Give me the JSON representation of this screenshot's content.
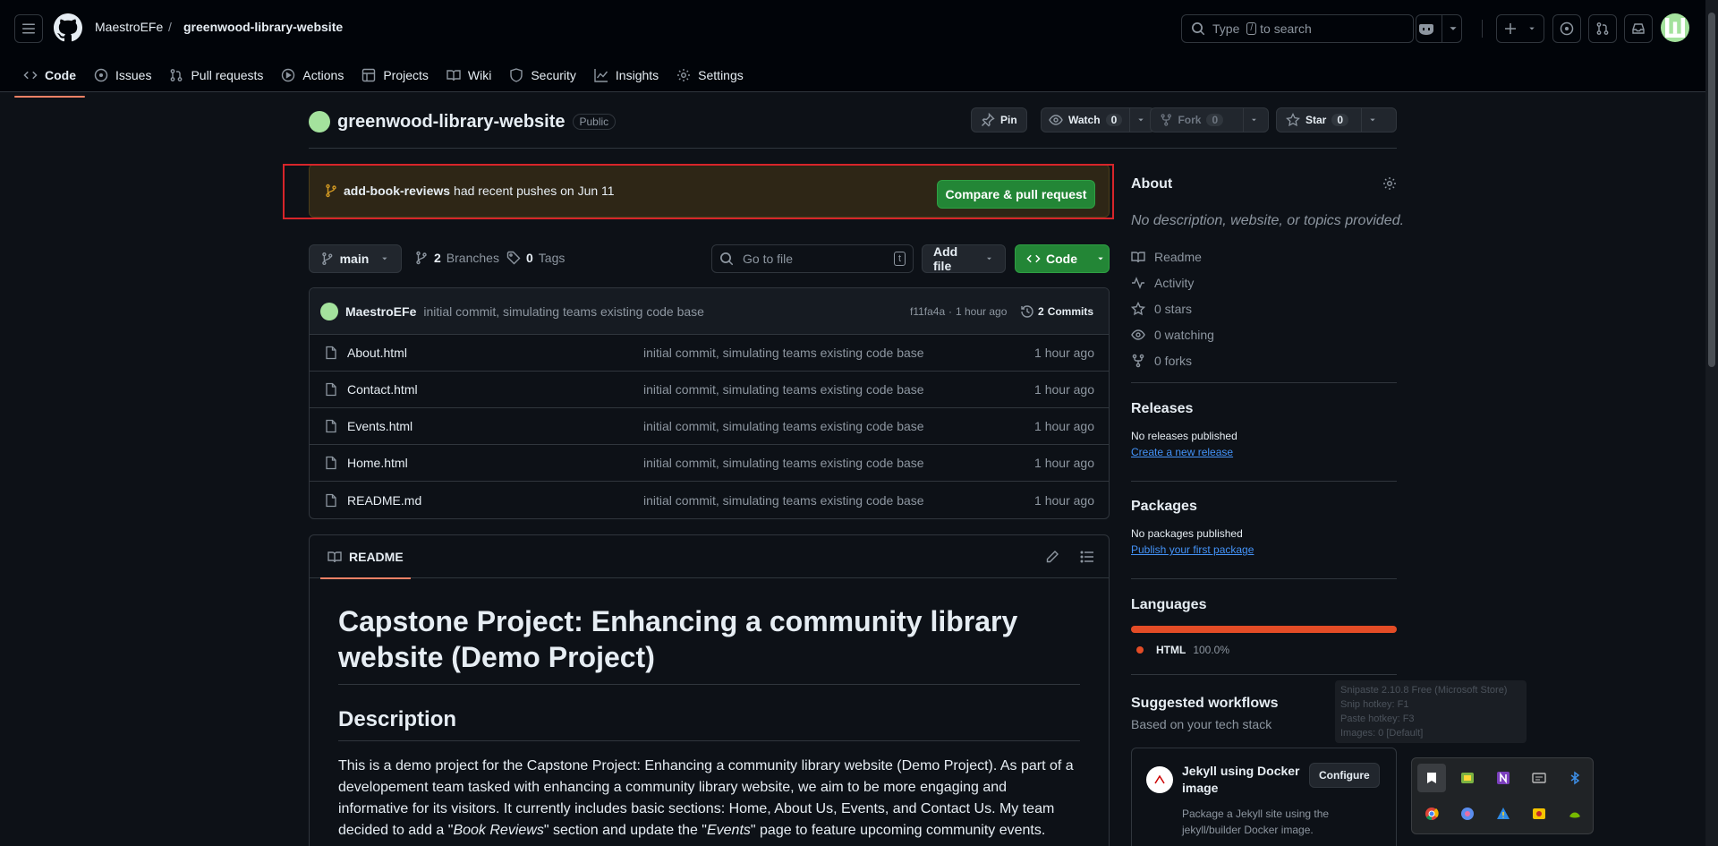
{
  "header": {
    "owner": "MaestroEFe",
    "separator": "/",
    "repo": "greenwood-library-website",
    "search_prefix": "Type",
    "search_key": "/",
    "search_suffix": "to search"
  },
  "nav": [
    {
      "label": "Code",
      "icon": "code-icon"
    },
    {
      "label": "Issues",
      "icon": "issue-icon"
    },
    {
      "label": "Pull requests",
      "icon": "pull-request-icon"
    },
    {
      "label": "Actions",
      "icon": "play-icon"
    },
    {
      "label": "Projects",
      "icon": "table-icon"
    },
    {
      "label": "Wiki",
      "icon": "book-icon"
    },
    {
      "label": "Security",
      "icon": "shield-icon"
    },
    {
      "label": "Insights",
      "icon": "graph-icon"
    },
    {
      "label": "Settings",
      "icon": "gear-icon"
    }
  ],
  "repo": {
    "name": "greenwood-library-website",
    "visibility": "Public",
    "pin": "Pin",
    "watch": "Watch",
    "watch_count": "0",
    "fork": "Fork",
    "fork_count": "0",
    "star": "Star",
    "star_count": "0"
  },
  "alert": {
    "branch": "add-book-reviews",
    "text": "had recent pushes on Jun 11",
    "button": "Compare & pull request"
  },
  "toolbar": {
    "branch": "main",
    "branches_count": "2",
    "branches_label": "Branches",
    "tags_count": "0",
    "tags_label": "Tags",
    "goto_placeholder": "Go to file",
    "goto_key": "t",
    "add_file": "Add file",
    "code": "Code"
  },
  "commit": {
    "author": "MaestroEFe",
    "message": "initial commit, simulating teams existing code base",
    "hash": "f11fa4a",
    "dot": "·",
    "time": "1 hour ago",
    "commits_count": "2",
    "commits_label": "Commits"
  },
  "files": [
    {
      "name": "About.html",
      "message": "initial commit, simulating teams existing code base",
      "time": "1 hour ago"
    },
    {
      "name": "Contact.html",
      "message": "initial commit, simulating teams existing code base",
      "time": "1 hour ago"
    },
    {
      "name": "Events.html",
      "message": "initial commit, simulating teams existing code base",
      "time": "1 hour ago"
    },
    {
      "name": "Home.html",
      "message": "initial commit, simulating teams existing code base",
      "time": "1 hour ago"
    },
    {
      "name": "README.md",
      "message": "initial commit, simulating teams existing code base",
      "time": "1 hour ago"
    }
  ],
  "readme": {
    "tab": "README",
    "h1": "Capstone Project: Enhancing a community library website (Demo Project)",
    "h2": "Description",
    "p_start": "This is a demo project for the Capstone Project: Enhancing a community library website (Demo Project). As part of a developement team tasked with enhancing a community library website, we aim to be more engaging and informative for its visitors. It currently includes basic sections: Home, About Us, Events, and Contact Us. My team decided to add a \"",
    "p_em1": "Book Reviews",
    "p_mid": "\" section and update the \"",
    "p_em2": "Events",
    "p_end": "\" page to feature upcoming community events."
  },
  "about": {
    "title": "About",
    "description": "No description, website, or topics provided.",
    "links": [
      {
        "label": "Readme",
        "icon": "book-icon"
      },
      {
        "label": "Activity",
        "icon": "pulse-icon"
      },
      {
        "label": "0 stars",
        "icon": "star-icon"
      },
      {
        "label": "0 watching",
        "icon": "eye-icon"
      },
      {
        "label": "0 forks",
        "icon": "fork-icon"
      }
    ]
  },
  "releases": {
    "title": "Releases",
    "text": "No releases published",
    "link": "Create a new release"
  },
  "packages": {
    "title": "Packages",
    "text": "No packages published",
    "link": "Publish your first package"
  },
  "languages": {
    "title": "Languages",
    "name": "HTML",
    "percent": "100.0%",
    "fraction": 1.0,
    "color": "#e34c26"
  },
  "workflows": {
    "title": "Suggested workflows",
    "subtitle": "Based on your tech stack",
    "card_title": "Jekyll using Docker image",
    "card_button": "Configure",
    "card_desc": "Package a Jekyll site using the jekyll/builder Docker image."
  },
  "tooltip": [
    "Snipaste 2.10.8 Free (Microsoft Store)",
    "Snip hotkey: F1",
    "Paste hotkey: F3",
    "Images: 0 [Default]"
  ],
  "colors": {
    "accent": "#f78166",
    "green": "#238636",
    "link": "#4493f8",
    "alert_border": "#d7252a"
  }
}
